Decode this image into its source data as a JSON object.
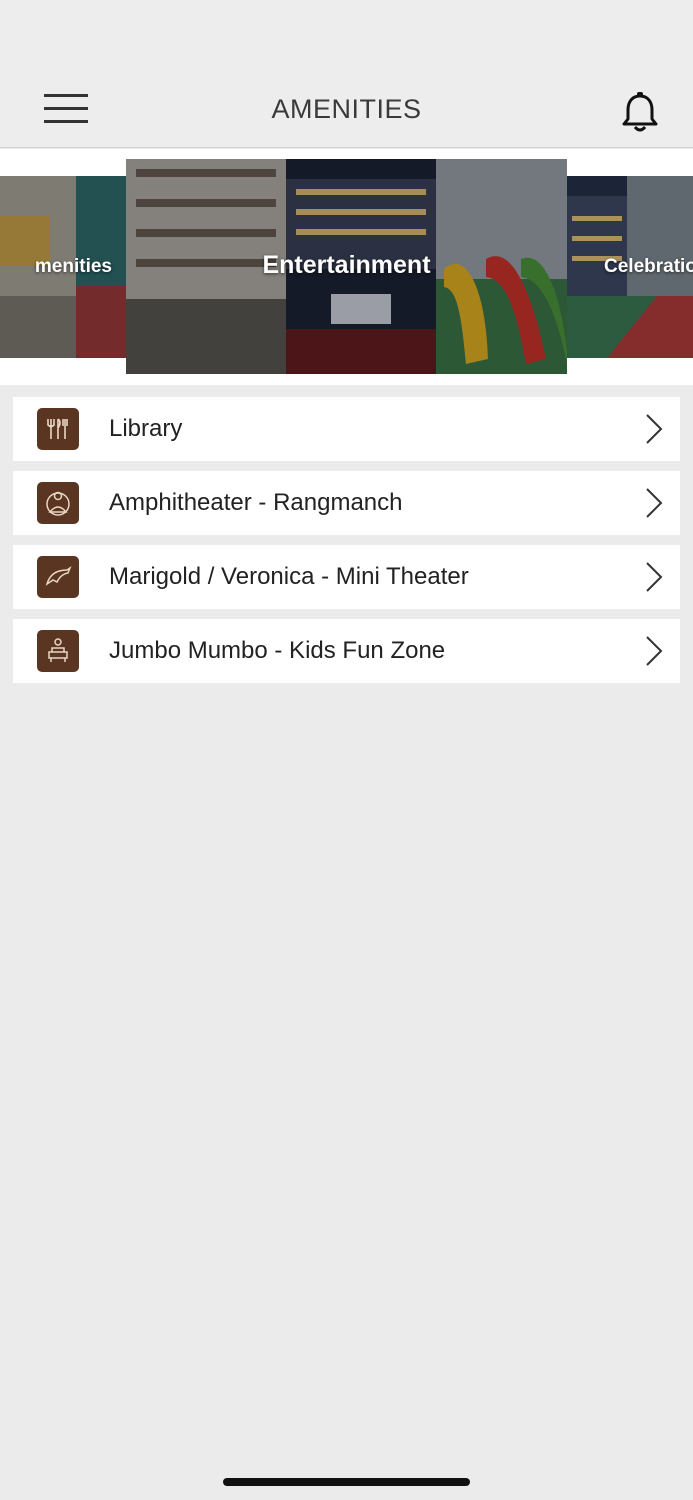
{
  "header": {
    "title": "AMENITIES",
    "menu_icon": "hamburger-menu-icon",
    "notification_icon": "bell-icon"
  },
  "carousel": {
    "slides": [
      {
        "label": "menities"
      },
      {
        "label": "Entertainment"
      },
      {
        "label": "Celebratio"
      }
    ]
  },
  "amenities": {
    "items": [
      {
        "label": "Library",
        "icon": "cutlery-icon"
      },
      {
        "label": "Amphitheater - Rangmanch",
        "icon": "meditation-icon"
      },
      {
        "label": "Marigold / Veronica - Mini Theater",
        "icon": "dolphin-icon"
      },
      {
        "label": "Jumbo Mumbo - Kids Fun Zone",
        "icon": "spa-chair-icon"
      }
    ]
  },
  "colors": {
    "background": "#ebebeb",
    "header_background": "#ededed",
    "icon_tile": "#5a3522",
    "list_item_background": "#ffffff"
  }
}
